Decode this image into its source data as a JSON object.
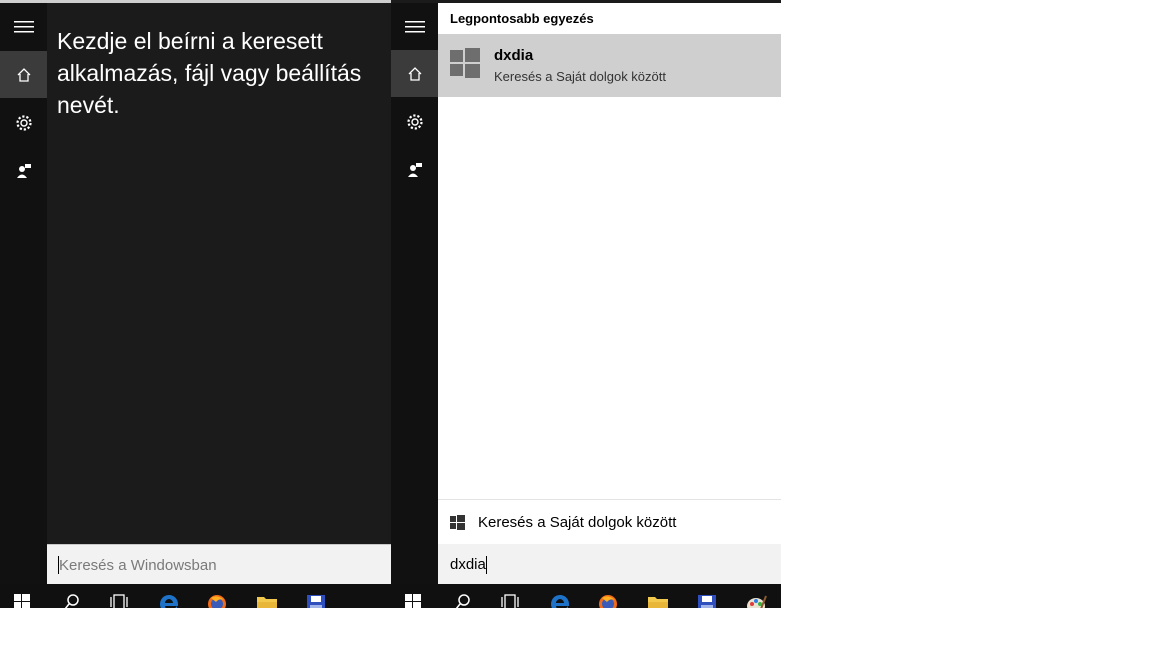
{
  "left": {
    "prompt_text": "Kezdje el beírni a keresett alkalmazás, fájl vagy beállítás nevét.",
    "search": {
      "placeholder": "Keresés a Windowsban",
      "value": ""
    }
  },
  "right": {
    "section_title": "Legpontosabb egyezés",
    "best_match": {
      "title": "dxdia",
      "subtitle": "Keresés a Saját dolgok között"
    },
    "search_my_stuff_label": "Keresés a Saját dolgok között",
    "search": {
      "value": "dxdia"
    }
  },
  "rail": {
    "items": [
      "menu-icon",
      "home-icon",
      "gear-icon",
      "feedback-icon"
    ],
    "active": "home-icon"
  },
  "taskbar": {
    "items": [
      "windows-start-icon",
      "search-icon",
      "task-view-icon",
      "edge-icon",
      "firefox-icon",
      "file-explorer-icon",
      "save-disk-icon",
      "paint-icon"
    ]
  },
  "colors": {
    "rail": "#111111",
    "dark_panel": "#1b1b1b",
    "selected_result": "#cfcfcf",
    "edge_blue": "#1e73c8",
    "firefox_orange": "#f06b1a",
    "folder_yellow": "#f2c94c"
  }
}
